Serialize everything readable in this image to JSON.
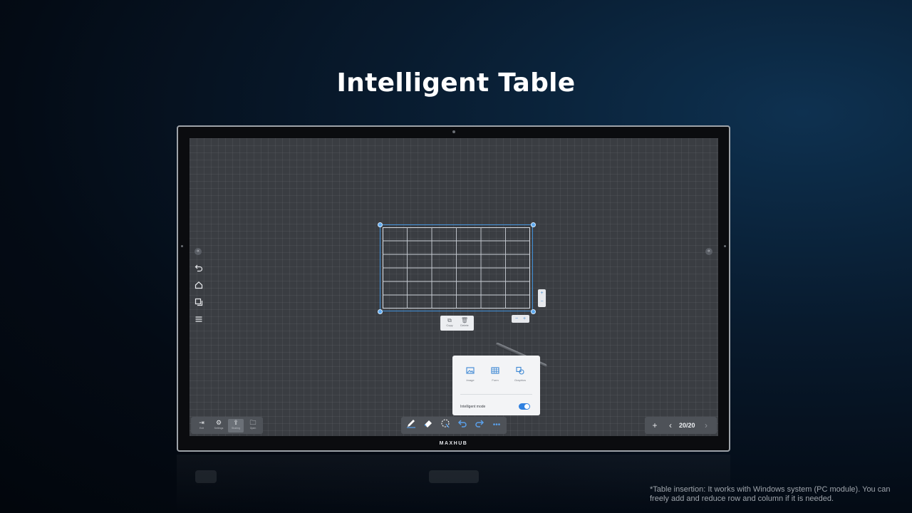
{
  "slide": {
    "title": "Intelligent Table",
    "footnote": "*Table insertion: It works with Windows system (PC module). You can freely add and reduce row and column if it is needed."
  },
  "device": {
    "brand": "MAXHUB"
  },
  "side_toolbar": {
    "collapse_icon": "double-chevron-left-icon",
    "items": [
      {
        "icon": "undo-icon"
      },
      {
        "icon": "home-icon"
      },
      {
        "icon": "pages-icon"
      },
      {
        "icon": "menu-icon"
      }
    ]
  },
  "table": {
    "rows": 6,
    "cols": 6,
    "row_controls": [
      "+",
      "−"
    ],
    "col_controls": [
      "−",
      "+"
    ]
  },
  "table_menu": [
    {
      "label": "Copy",
      "icon": "copy-icon"
    },
    {
      "label": "Delete",
      "icon": "trash-icon"
    }
  ],
  "insert_popup": {
    "items": [
      {
        "label": "Image",
        "icon": "image-icon"
      },
      {
        "label": "Form",
        "icon": "table-icon"
      },
      {
        "label": "Graphics",
        "icon": "shapes-icon"
      }
    ],
    "intelligent_mode_label": "Intelligent mode",
    "intelligent_mode_on": true
  },
  "bottom_left_toolbar": [
    {
      "label": "Exit",
      "icon": "exit-icon",
      "active": false
    },
    {
      "label": "Settings",
      "icon": "gear-icon",
      "active": false
    },
    {
      "label": "Sharing",
      "icon": "share-icon",
      "active": true
    },
    {
      "label": "Open",
      "icon": "folder-icon",
      "active": false
    }
  ],
  "bottom_center_toolbar": [
    {
      "icon": "pen-icon"
    },
    {
      "icon": "eraser-icon"
    },
    {
      "icon": "lasso-select-icon"
    },
    {
      "icon": "undo-icon"
    },
    {
      "icon": "redo-icon"
    },
    {
      "icon": "more-icon"
    }
  ],
  "page_nav": {
    "counter": "20/20",
    "add_icon": "plus-icon",
    "prev_icon": "chevron-left-icon",
    "next_icon": "chevron-right-icon"
  },
  "colors": {
    "accent": "#2f80e0",
    "screen_bg": "#3a3d42",
    "selection": "#3f8fd8"
  }
}
